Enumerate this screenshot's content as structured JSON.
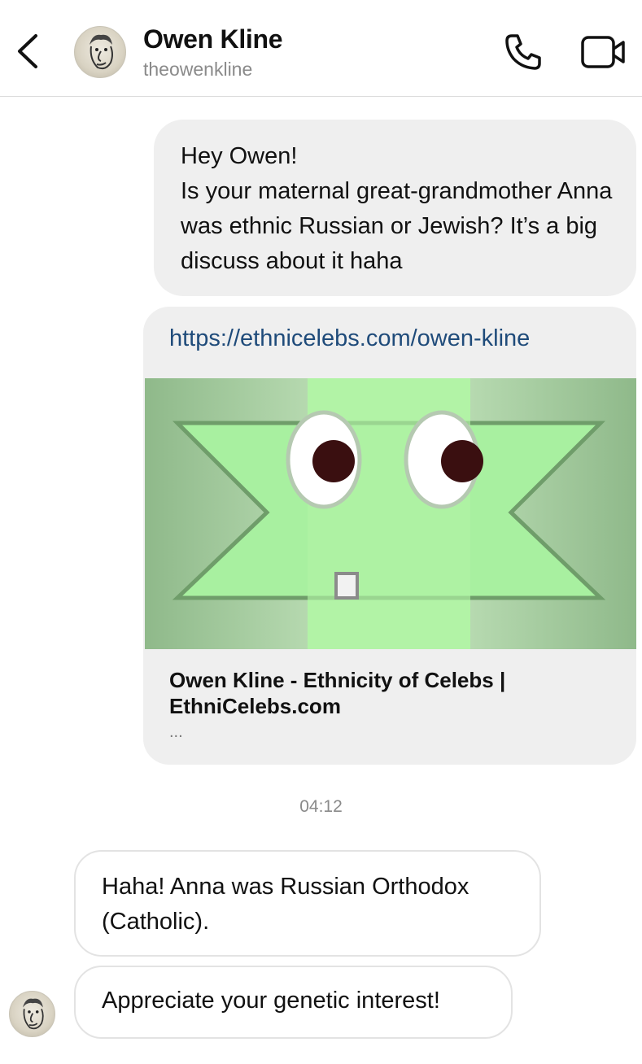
{
  "header": {
    "name": "Owen Kline",
    "username": "theowenkline",
    "icons": [
      "back-chevron-icon",
      "phone-icon",
      "video-camera-icon"
    ]
  },
  "messages": [
    {
      "direction": "outgoing",
      "text": "Hey Owen!\nIs your maternal great-grandmother Anna was ethnic Russian or Jewish? It’s a big discuss about it haha"
    },
    {
      "direction": "outgoing",
      "type": "link",
      "url": "https://ethnicelebs.com/owen-kline",
      "preview_title": "Owen Kline - Ethnicity of Celebs | EthniCelebs.com",
      "preview_description": "..."
    }
  ],
  "timestamp": "04:12",
  "replies": [
    {
      "direction": "incoming",
      "text": "Haha! Anna was Russian Orthodox (Catholic)."
    },
    {
      "direction": "incoming",
      "text": "Appreciate your genetic interest!"
    }
  ],
  "colors": {
    "outgoing_bubble": "#efefef",
    "incoming_border": "#e3e3e3",
    "link": "#1f4b7a",
    "muted": "#8a8a8a",
    "preview_green": "#a8f0a0"
  }
}
